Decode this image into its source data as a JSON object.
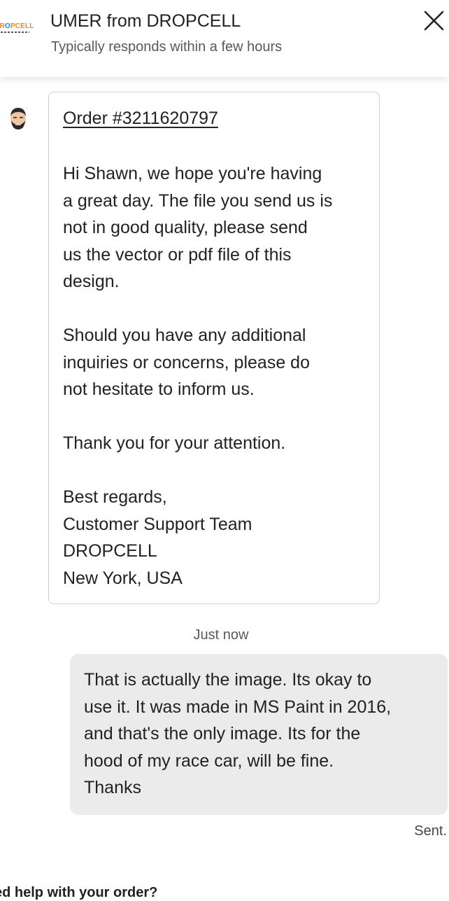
{
  "header": {
    "logo_text": "DROPCELL",
    "title": "UMER from DROPCELL",
    "subtitle": "Typically responds within a few hours"
  },
  "conversation": {
    "incoming": {
      "order_link": "Order #3211620797",
      "lines": [
        "Hi Shawn, we hope you're having",
        "a great day. The file you send us is",
        "not in good quality, please send",
        "us the vector or pdf file of this",
        "design.",
        "Should you have any additional",
        "inquiries or concerns, please do",
        "not hesitate to inform us.",
        "Thank you for your attention.",
        "Best regards,",
        "Customer Support Team",
        "DROPCELL",
        "New York, USA"
      ]
    },
    "timestamp": "Just now",
    "outgoing": {
      "lines": [
        "That is actually the image. Its okay to",
        "use it. It was made in MS Paint in 2016,",
        "and that's the only image. Its for the",
        "hood of my race car, will be fine.",
        "Thanks"
      ],
      "status": "Sent."
    }
  },
  "footer": {
    "help_prompt": "ed help with your order?"
  },
  "icons": {
    "close": "close-icon",
    "avatar": "avatar-icon"
  },
  "colors": {
    "outgoing_bubble": "#ebebeb",
    "bubble_border": "#cfcfcf",
    "text": "#222222",
    "muted": "#595959",
    "logo_orange": "#f08a1c",
    "logo_blue": "#1e88e5"
  }
}
